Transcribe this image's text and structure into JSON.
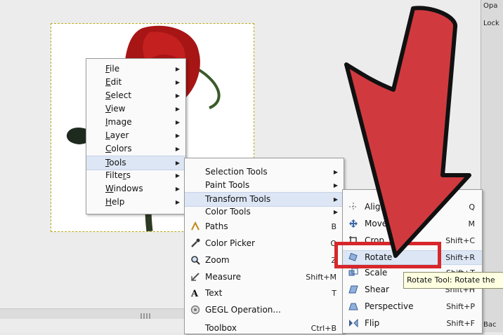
{
  "menu_main": {
    "items": [
      {
        "label": "File",
        "u": "F"
      },
      {
        "label": "Edit",
        "u": "E"
      },
      {
        "label": "Select",
        "u": "S"
      },
      {
        "label": "View",
        "u": "V"
      },
      {
        "label": "Image",
        "u": "I"
      },
      {
        "label": "Layer",
        "u": "L"
      },
      {
        "label": "Colors",
        "u": "C"
      },
      {
        "label": "Tools",
        "u": "T"
      },
      {
        "label": "Filters",
        "u": "r"
      },
      {
        "label": "Windows",
        "u": "W"
      },
      {
        "label": "Help",
        "u": "H"
      }
    ],
    "highlighted": "Tools"
  },
  "menu_tools": {
    "items": [
      {
        "label": "Selection Tools",
        "shortcut": "",
        "submenu": true
      },
      {
        "label": "Paint Tools",
        "shortcut": "",
        "submenu": true
      },
      {
        "label": "Transform Tools",
        "shortcut": "",
        "submenu": true
      },
      {
        "label": "Color Tools",
        "shortcut": "",
        "submenu": true
      },
      {
        "label": "Paths",
        "shortcut": "B",
        "icon": "paths-icon"
      },
      {
        "label": "Color Picker",
        "shortcut": "O",
        "icon": "color-picker-icon"
      },
      {
        "label": "Zoom",
        "shortcut": "Z",
        "icon": "zoom-icon"
      },
      {
        "label": "Measure",
        "shortcut": "Shift+M",
        "icon": "measure-icon"
      },
      {
        "label": "Text",
        "shortcut": "T",
        "icon": "text-icon"
      },
      {
        "label": "GEGL Operation...",
        "shortcut": "",
        "icon": "gegl-icon"
      },
      {
        "label": "Toolbox",
        "shortcut": "Ctrl+B"
      }
    ],
    "highlighted": "Transform Tools"
  },
  "menu_transform": {
    "items": [
      {
        "label": "Align",
        "shortcut": "Q",
        "icon": "align-icon"
      },
      {
        "label": "Move",
        "shortcut": "M",
        "icon": "move-icon"
      },
      {
        "label": "Crop",
        "shortcut": "Shift+C",
        "icon": "crop-icon"
      },
      {
        "label": "Rotate",
        "shortcut": "Shift+R",
        "icon": "rotate-icon"
      },
      {
        "label": "Scale",
        "shortcut": "Shift+T",
        "icon": "scale-icon"
      },
      {
        "label": "Shear",
        "shortcut": "Shift+H",
        "icon": "shear-icon"
      },
      {
        "label": "Perspective",
        "shortcut": "Shift+P",
        "icon": "perspective-icon"
      },
      {
        "label": "Flip",
        "shortcut": "Shift+F",
        "icon": "flip-icon"
      }
    ],
    "highlighted": "Rotate"
  },
  "tooltip": "Rotate Tool: Rotate the",
  "right_panel": {
    "top_label": "Opa",
    "lock_label": "Lock",
    "bottom_label": "Bac"
  },
  "colors": {
    "arrow": "#d03a3f",
    "highlight_box": "#d7272b",
    "rose": "#b01717"
  }
}
